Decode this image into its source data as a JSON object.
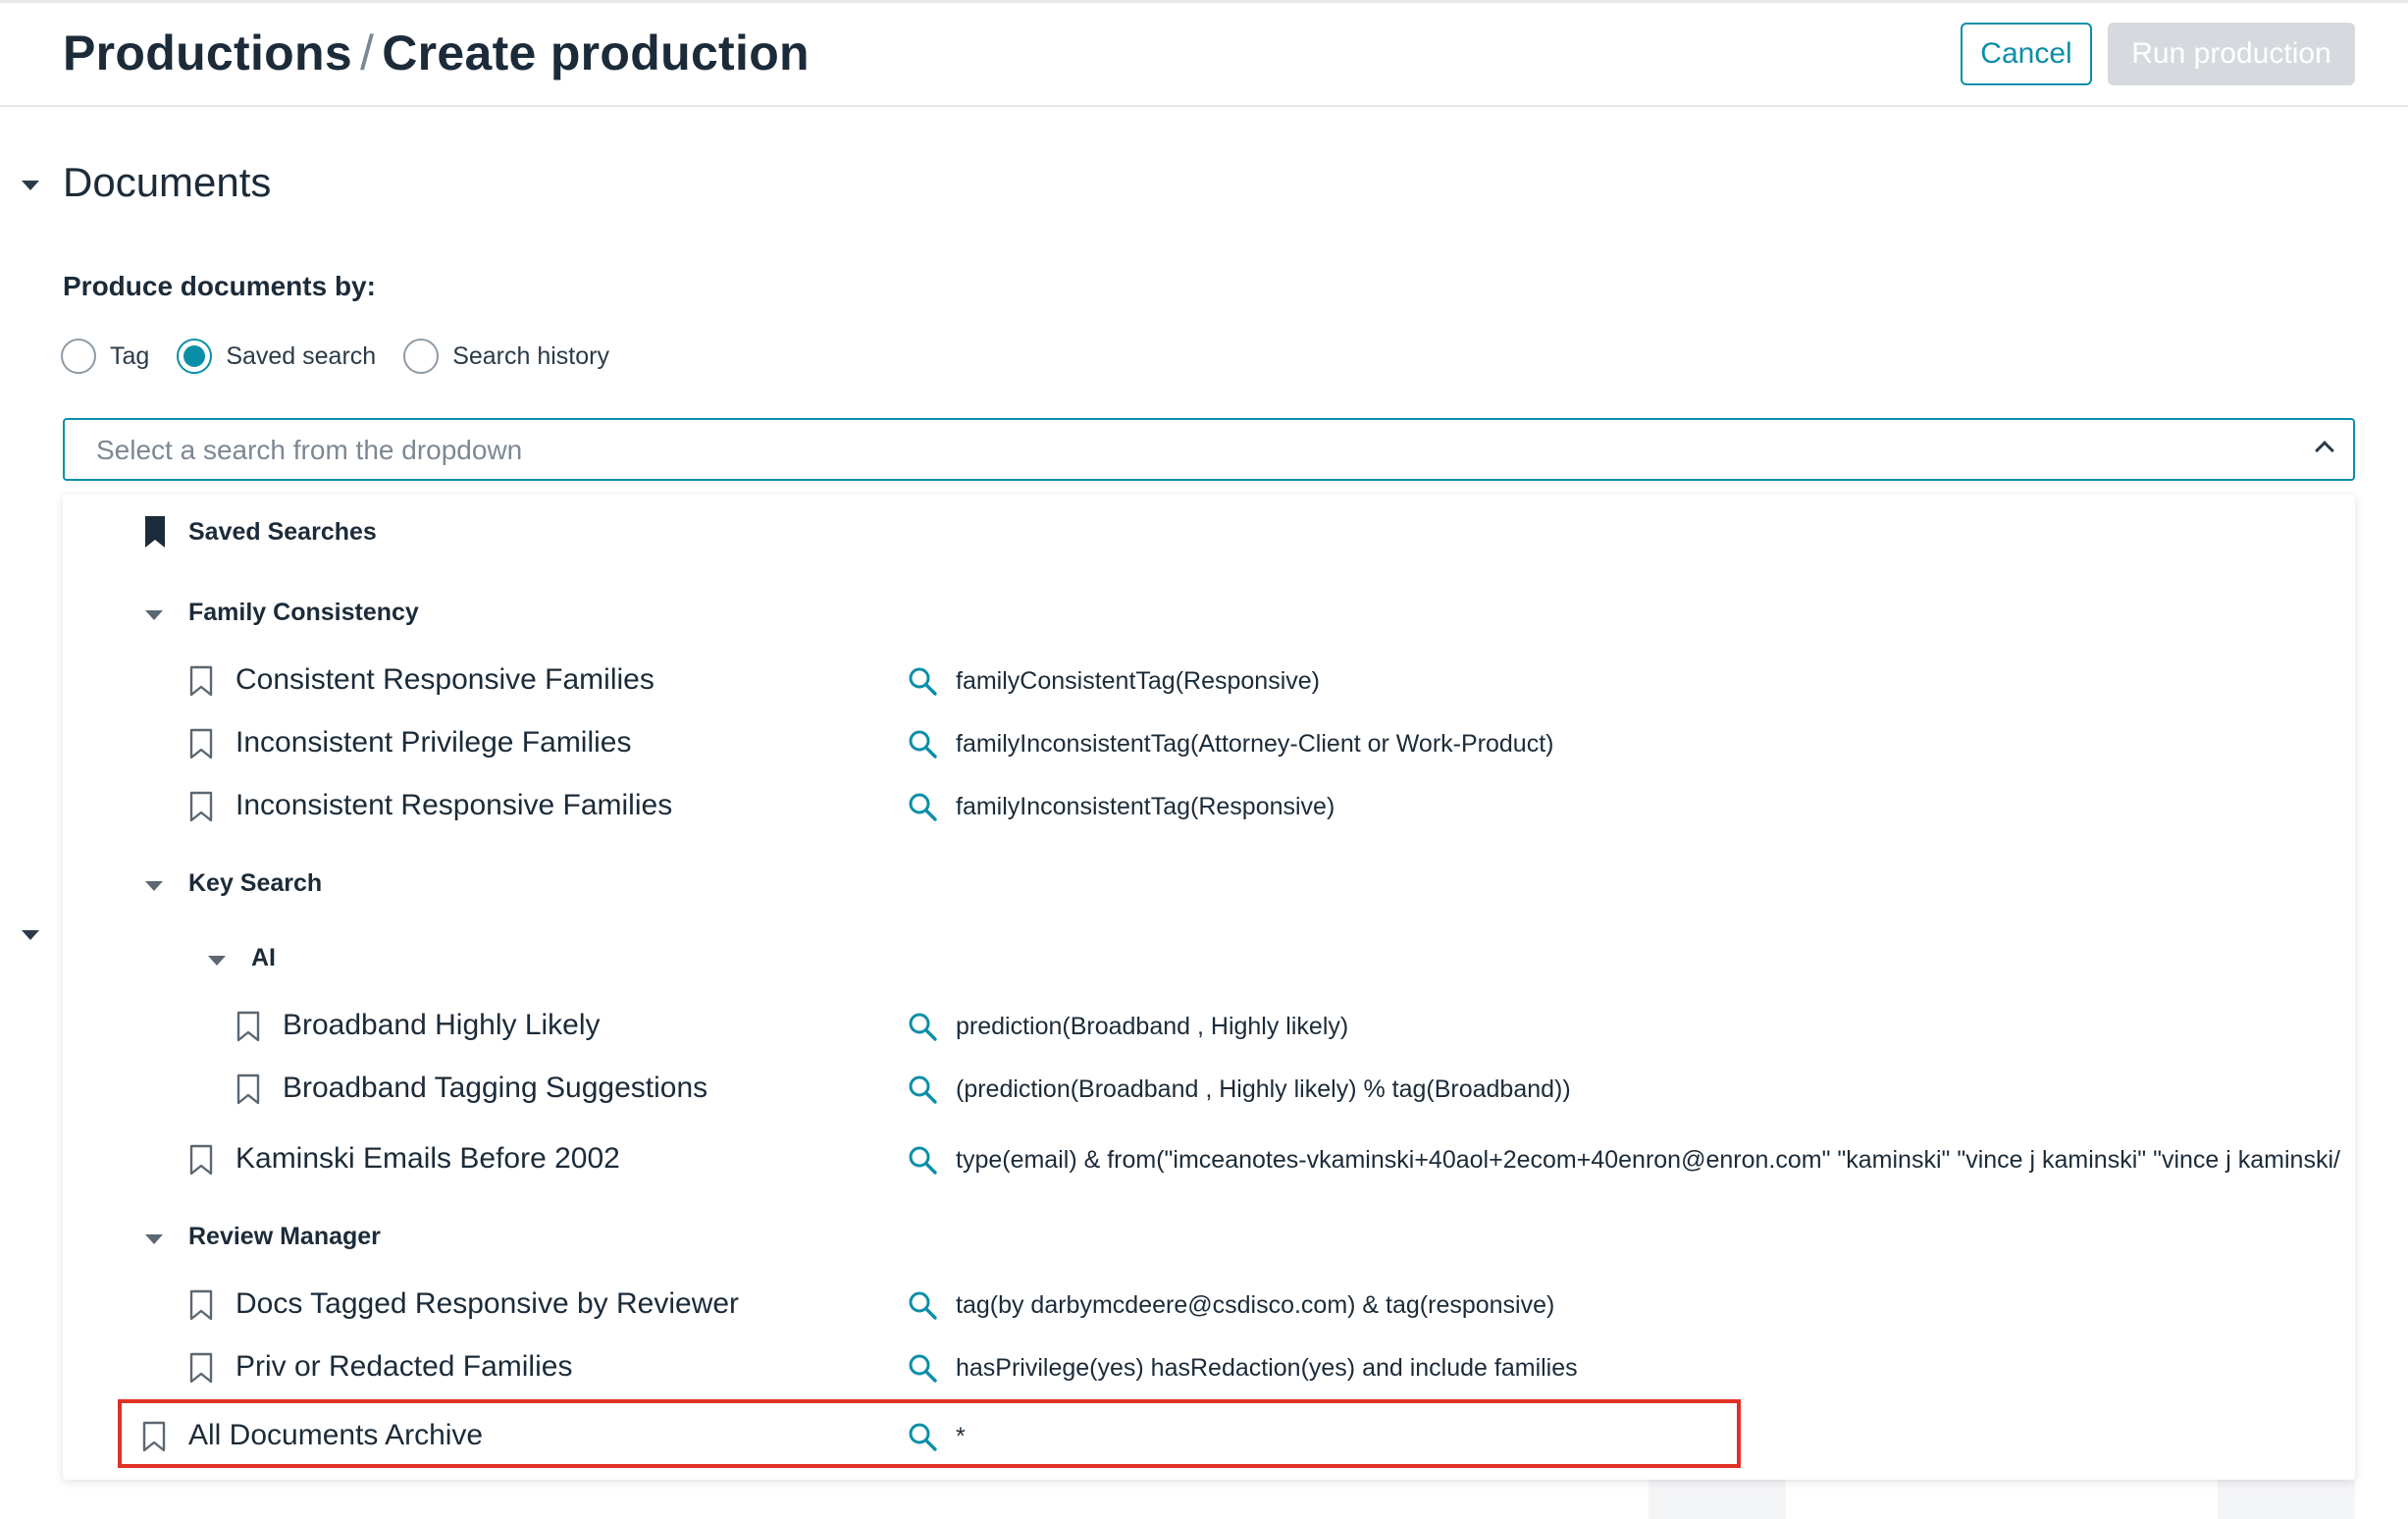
{
  "header": {
    "breadcrumb_root": "Productions",
    "separator": "/",
    "page_title": "Create production",
    "cancel_label": "Cancel",
    "run_label": "Run production"
  },
  "documents": {
    "section_title": "Documents",
    "produce_label": "Produce documents by:",
    "radio_options": [
      {
        "label": "Tag",
        "checked": false
      },
      {
        "label": "Saved search",
        "checked": true
      },
      {
        "label": "Search history",
        "checked": false
      }
    ],
    "select_placeholder": "Select a search from the dropdown"
  },
  "dropdown": {
    "root_label": "Saved Searches",
    "groups": {
      "family": "Family Consistency",
      "key": "Key Search",
      "ai": "AI",
      "review": "Review Manager"
    },
    "items": [
      {
        "label": "Consistent Responsive Families",
        "query": "familyConsistentTag(Responsive)"
      },
      {
        "label": "Inconsistent Privilege Families",
        "query": "familyInconsistentTag(Attorney-Client or Work-Product)"
      },
      {
        "label": "Inconsistent Responsive Families",
        "query": "familyInconsistentTag(Responsive)"
      },
      {
        "label": "Broadband Highly Likely",
        "query": "prediction(Broadband , Highly likely)"
      },
      {
        "label": "Broadband Tagging Suggestions",
        "query": "(prediction(Broadband , Highly likely) % tag(Broadband))"
      },
      {
        "label": "Kaminski Emails Before 2002",
        "query": "type(email) & from(\"imceanotes-vkaminski+40aol+2ecom+40enron@enron.com\" \"kaminski\" \"vince j kaminski\" \"vince j kaminski/"
      },
      {
        "label": "Docs Tagged Responsive by Reviewer",
        "query": "tag(by darbymcdeere@csdisco.com) & tag(responsive)"
      },
      {
        "label": "Priv or Redacted Families",
        "query": "hasPrivilege(yes) hasRedaction(yes) and include families"
      },
      {
        "label": "All Documents Archive",
        "query": "*"
      }
    ]
  },
  "colors": {
    "accent": "#0b8fa8",
    "highlight": "#e03127",
    "disabled": "#d6dadf"
  }
}
